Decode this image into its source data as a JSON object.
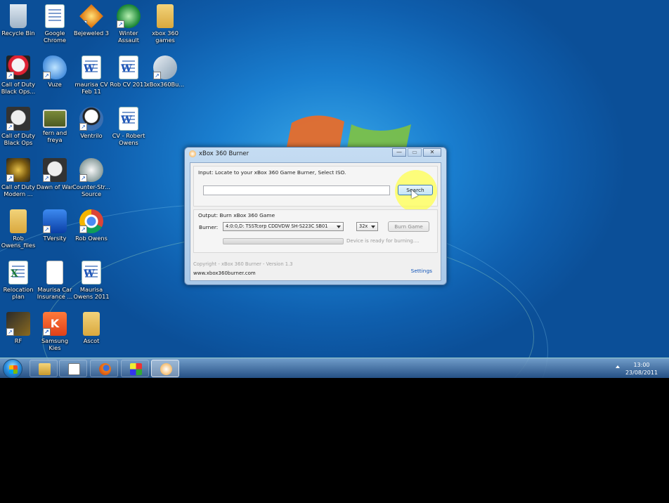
{
  "desktop": {
    "icons": [
      {
        "label": "Recycle Bin",
        "icon": "recycle-bin-icon"
      },
      {
        "label": "Google Chrome",
        "icon": "google-chrome-doc-icon"
      },
      {
        "label": "Bejeweled 3",
        "icon": "bejeweled-icon"
      },
      {
        "label": "Winter Assault",
        "icon": "winter-assault-icon"
      },
      {
        "label": "xbox 360 games",
        "icon": "folder-icon"
      },
      {
        "label": "Call of Duty Black Ops...",
        "icon": "black-ops-icon"
      },
      {
        "label": "Vuze",
        "icon": "vuze-icon"
      },
      {
        "label": "maurisa CV Feb 11",
        "icon": "word-doc-icon"
      },
      {
        "label": "Rob CV 2011",
        "icon": "word-doc-icon"
      },
      {
        "label": "xBox360Bu...",
        "icon": "xbox360burner-icon"
      },
      {
        "label": "Call of Duty Black Ops",
        "icon": "black-ops-icon"
      },
      {
        "label": "fern and freya",
        "icon": "photo-icon"
      },
      {
        "label": "Ventrilo",
        "icon": "ventrilo-icon"
      },
      {
        "label": "CV - Robert Owens",
        "icon": "word-doc-icon"
      },
      {
        "label": "Call of Duty Modern ...",
        "icon": "modern-warfare-icon"
      },
      {
        "label": "Dawn of War",
        "icon": "dawn-of-war-icon"
      },
      {
        "label": "Counter-Str... Source",
        "icon": "counter-strike-icon"
      },
      {
        "label": "Rob Owens_files",
        "icon": "folder-icon"
      },
      {
        "label": "TVersity",
        "icon": "tversity-icon"
      },
      {
        "label": "Rob Owens",
        "icon": "chrome-icon"
      },
      {
        "label": "Relocation plan",
        "icon": "excel-doc-icon"
      },
      {
        "label": "Maurisa Car Insurance ...",
        "icon": "blank-doc-icon"
      },
      {
        "label": "Maurisa Owens 2011",
        "icon": "word-doc-icon"
      },
      {
        "label": "RF",
        "icon": "rf-icon"
      },
      {
        "label": "Samsung Kies",
        "icon": "samsung-kies-icon"
      },
      {
        "label": "Ascot",
        "icon": "folder-icon"
      }
    ]
  },
  "dialog": {
    "title": "xBox 360 Burner",
    "minimize": "—",
    "maximize": "▭",
    "close": "✕",
    "input_group_label": "Input: Locate to your xBox 360 Game Burner, Select ISO.",
    "iso_value": "",
    "search_label": "Search",
    "output_group_label": "Output: Burn xBox 360 Game",
    "burner_label": "Burner:",
    "burner_value": "4:0:0,D: TSSTcorp CDDVDW SH-S223C SB01",
    "speed_value": "32x",
    "burn_label": "Burn Game",
    "progress": 0,
    "status_text": "Device is ready for burning....",
    "copyright": "Copyright - xBox 360 Burner - Version 1.3",
    "website": "www.xbox360burner.com",
    "settings_label": "Settings"
  },
  "taskbar": {
    "buttons": [
      {
        "icon": "windows-explorer-icon"
      },
      {
        "icon": "notepad-icon"
      },
      {
        "icon": "firefox-icon"
      },
      {
        "icon": "bejeweled-taskbar-icon"
      },
      {
        "icon": "xbox360burner-taskbar-icon",
        "active": true
      }
    ],
    "time": "13:00",
    "date": "23/08/2011"
  },
  "colors": {
    "desktop_blue": "#1a7fd0",
    "link_blue": "#0f53b8",
    "highlight_yellow": "#ffff50"
  }
}
